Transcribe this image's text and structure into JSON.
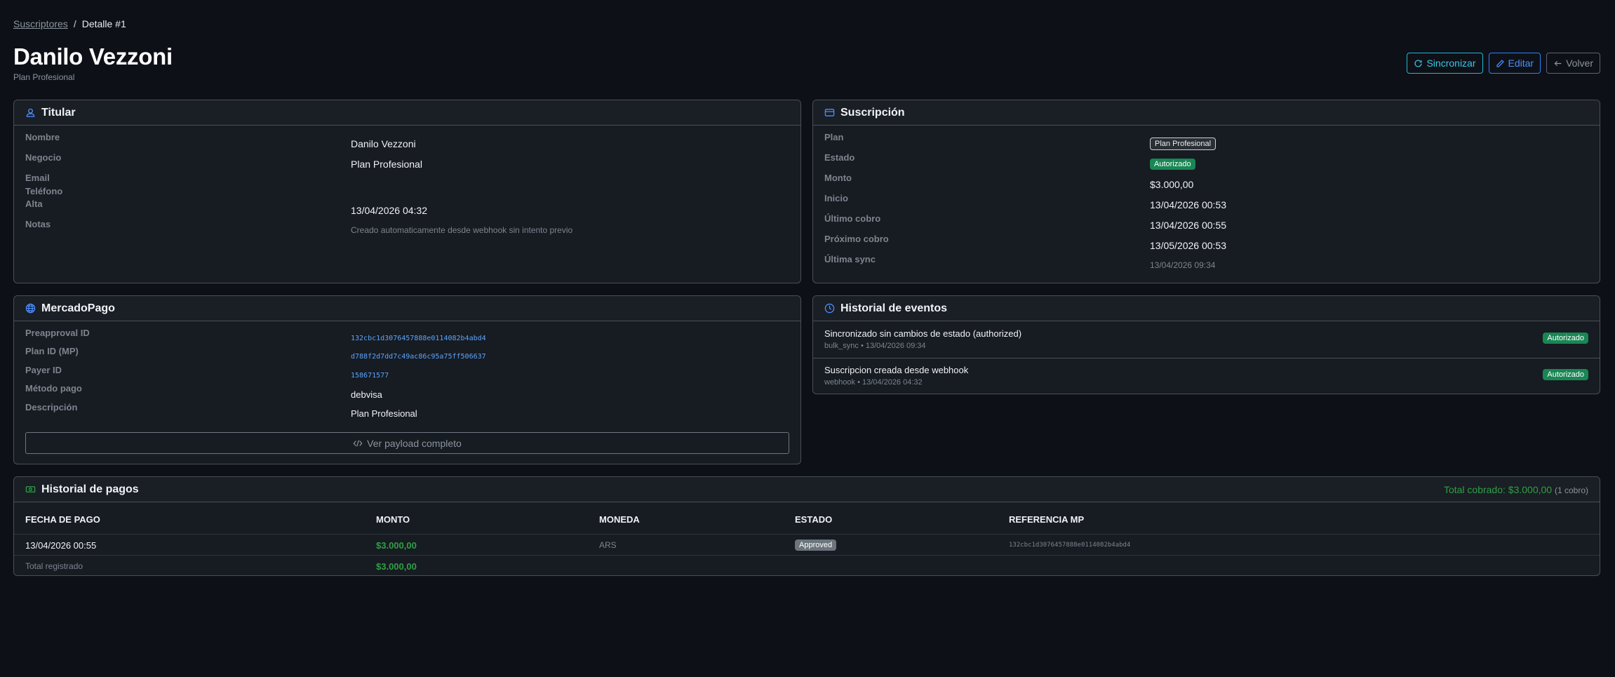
{
  "breadcrumb": {
    "parent": "Suscriptores",
    "separator": "/",
    "current": "Detalle #1"
  },
  "header": {
    "title": "Danilo Vezzoni",
    "subtitle": "Plan Profesional"
  },
  "actions": {
    "sync_label": "Sincronizar",
    "edit_label": "Editar",
    "back_label": "Volver"
  },
  "titular": {
    "title": "Titular",
    "rows": [
      {
        "key": "Nombre",
        "value": "Danilo Vezzoni"
      },
      {
        "key": "Negocio",
        "value": "Plan Profesional"
      },
      {
        "key": "Email",
        "value": ""
      },
      {
        "key": "Teléfono",
        "value": ""
      },
      {
        "key": "Alta",
        "value": "13/04/2026 04:32"
      },
      {
        "key": "Notas",
        "value": "Creado automaticamente desde webhook sin intento previo"
      }
    ]
  },
  "suscripcion": {
    "title": "Suscripción",
    "rows": [
      {
        "key": "Plan",
        "value": "Plan Profesional"
      },
      {
        "key": "Estado",
        "value": "Autorizado"
      },
      {
        "key": "Monto",
        "value": "$3.000,00"
      },
      {
        "key": "Inicio",
        "value": "13/04/2026 00:53"
      },
      {
        "key": "Último cobro",
        "value": "13/04/2026 00:55"
      },
      {
        "key": "Próximo cobro",
        "value": "13/05/2026 00:53"
      },
      {
        "key": "Última sync",
        "value": "13/04/2026 09:34"
      }
    ]
  },
  "mercadopago": {
    "title": "MercadoPago",
    "rows": [
      {
        "key": "Preapproval ID",
        "value": "132cbc1d3076457888e0114082b4abd4"
      },
      {
        "key": "Plan ID (MP)",
        "value": "d788f2d7dd7c49ac86c95a75ff506637"
      },
      {
        "key": "Payer ID",
        "value": "158671577"
      },
      {
        "key": "Método pago",
        "value": "debvisa"
      },
      {
        "key": "Descripción",
        "value": "Plan Profesional"
      }
    ],
    "payload_label": "Ver payload completo"
  },
  "eventos": {
    "title": "Historial de eventos",
    "items": [
      {
        "title": "Sincronizado sin cambios de estado (authorized)",
        "meta": "bulk_sync • 13/04/2026 09:34",
        "badge": "Autorizado"
      },
      {
        "title": "Suscripcion creada desde webhook",
        "meta": "webhook • 13/04/2026 04:32",
        "badge": "Autorizado"
      }
    ]
  },
  "pagos": {
    "title": "Historial de pagos",
    "total_label": "Total cobrado: $3.000,00",
    "count_label": "(1 cobro)",
    "columns": [
      "FECHA DE PAGO",
      "MONTO",
      "MONEDA",
      "ESTADO",
      "REFERENCIA MP"
    ],
    "rows": [
      {
        "fecha": "13/04/2026 00:55",
        "monto": "$3.000,00",
        "moneda": "ARS",
        "estado": "Approved",
        "referencia": "132cbc1d3076457888e0114082b4abd4"
      }
    ],
    "footer_label": "Total registrado",
    "footer_total": "$3.000,00"
  },
  "colors": {
    "background": "#0d1117",
    "card": "#171b22",
    "success": "#198754",
    "accent_blue": "#2f7fff",
    "accent_cyan": "#1fb6d6"
  },
  "icons": {
    "titular": "person-icon",
    "suscripcion": "credit-card-icon",
    "mercadopago": "globe-icon",
    "eventos": "clock-icon",
    "pagos": "cash-icon"
  }
}
